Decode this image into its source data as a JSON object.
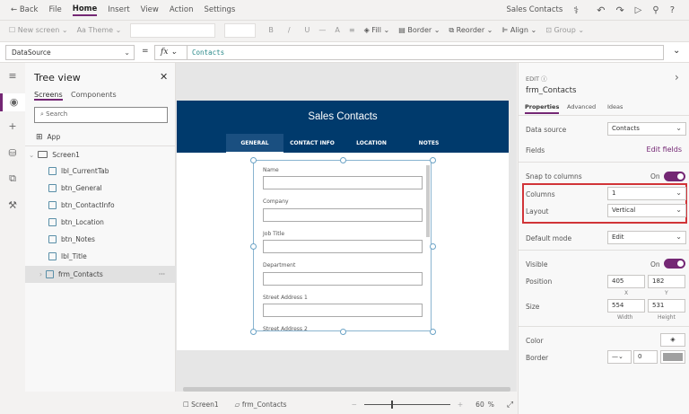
{
  "menu": {
    "back": "Back",
    "items": [
      "File",
      "Home",
      "Insert",
      "View",
      "Action",
      "Settings"
    ],
    "app_name": "Sales Contacts"
  },
  "toolbar": {
    "new_screen": "New screen",
    "theme": "Theme",
    "fill": "Fill",
    "border": "Border",
    "reorder": "Reorder",
    "align": "Align",
    "group": "Group"
  },
  "formula": {
    "property": "DataSource",
    "equals": "=",
    "fx": "fx",
    "value": "Contacts"
  },
  "tree": {
    "title": "Tree view",
    "tabs": [
      "Screens",
      "Components"
    ],
    "search_placeholder": "Search",
    "app": "App",
    "screen": "Screen1",
    "items": [
      "lbl_CurrentTab",
      "btn_General",
      "btn_ContactInfo",
      "btn_Location",
      "btn_Notes",
      "lbl_Title",
      "frm_Contacts"
    ],
    "more": "···"
  },
  "app": {
    "title": "Sales Contacts",
    "tabs": [
      "GENERAL",
      "CONTACT INFO",
      "LOCATION",
      "NOTES"
    ],
    "fields": [
      "Name",
      "Company",
      "Job Title",
      "Department",
      "Street Address 1",
      "Street Address 2"
    ]
  },
  "status": {
    "screen": "Screen1",
    "control": "frm_Contacts",
    "zoom": "60",
    "zoom_unit": "%",
    "minus": "−",
    "plus": "+"
  },
  "props": {
    "type": "EDIT",
    "name": "frm_Contacts",
    "tabs": [
      "Properties",
      "Advanced",
      "Ideas"
    ],
    "data_source_label": "Data source",
    "data_source": "Contacts",
    "fields_label": "Fields",
    "edit_fields": "Edit fields",
    "snap_label": "Snap to columns",
    "on": "On",
    "columns_label": "Columns",
    "columns": "1",
    "layout_label": "Layout",
    "layout": "Vertical",
    "default_mode_label": "Default mode",
    "default_mode": "Edit",
    "visible_label": "Visible",
    "position_label": "Position",
    "x": "405",
    "y": "182",
    "x_label": "X",
    "y_label": "Y",
    "size_label": "Size",
    "width": "554",
    "height": "531",
    "width_label": "Width",
    "height_label": "Height",
    "color_label": "Color",
    "border_label": "Border",
    "border_width": "0"
  },
  "colors": {
    "accent": "#742774",
    "header": "#003a6c",
    "highlight": "#d13438"
  }
}
